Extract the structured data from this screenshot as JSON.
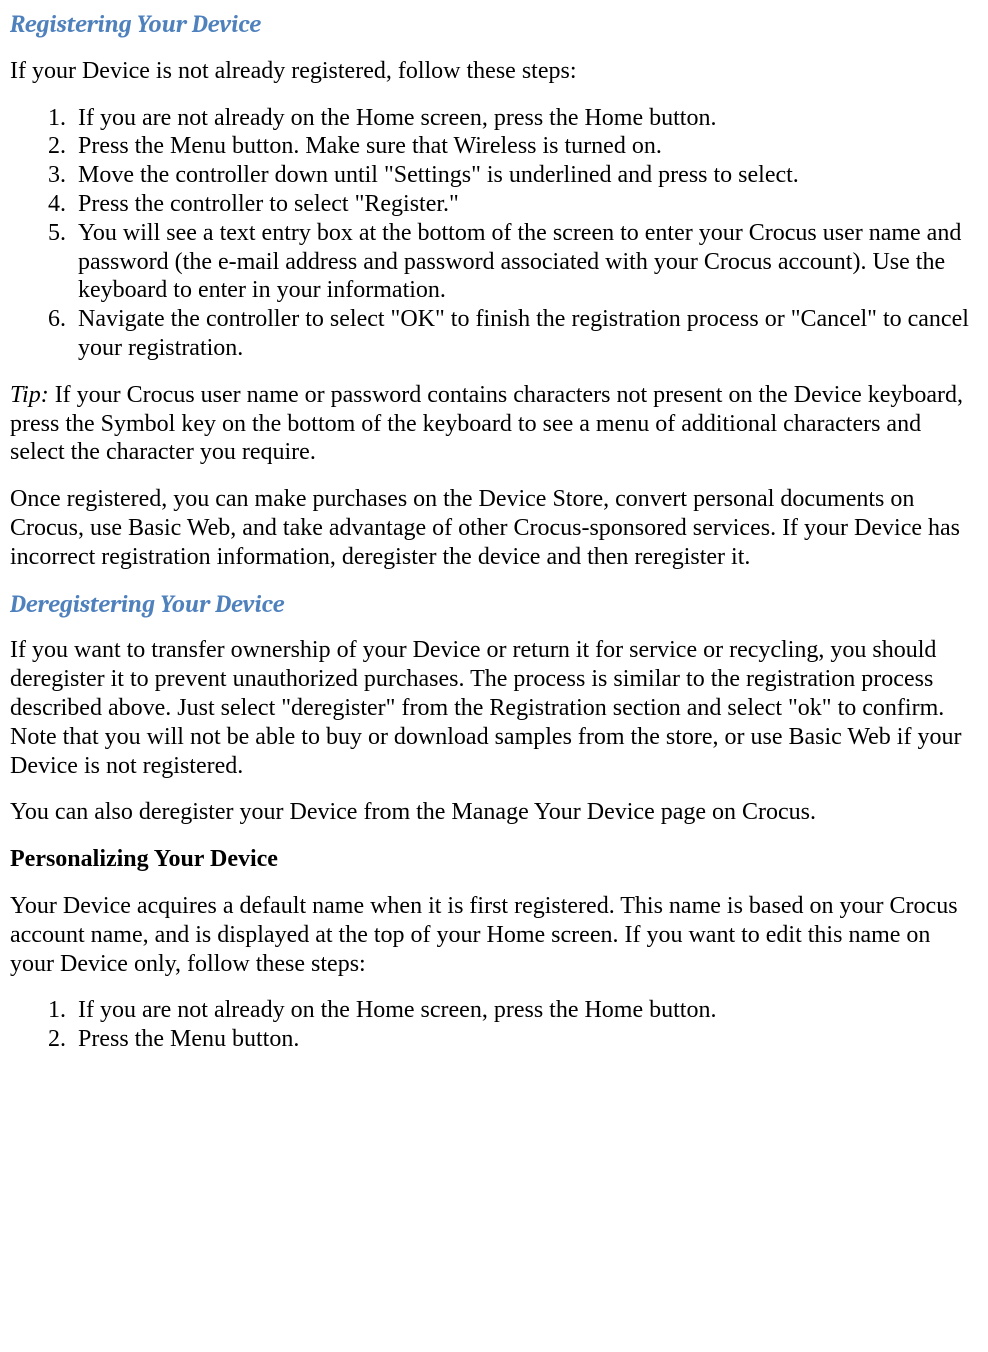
{
  "heading1": "Registering Your Device",
  "para1": "If your Device is not already registered, follow these steps:",
  "list1": [
    "If you are not already on the Home screen, press the Home button.",
    "Press the Menu button. Make sure that Wireless is turned on.",
    "Move the controller down until \"Settings\" is underlined and press to select.",
    "Press the controller to select \"Register.\"",
    "You will see a text entry box at the bottom of the screen to enter your Crocus user name and password (the e-mail address and password associated with your Crocus account). Use the keyboard to enter in your information.",
    "Navigate the controller to select \"OK\" to finish the registration process or \"Cancel\" to cancel your registration."
  ],
  "tip_label": "Tip:",
  "tip_body": " If your Crocus user name or password contains characters not present on the Device keyboard, press the Symbol key on the bottom of the keyboard to see a menu of additional characters and select the character you require.",
  "para2": "Once registered, you can make purchases on the Device Store, convert personal documents on Crocus, use Basic Web, and take advantage of other Crocus-sponsored services. If your Device has incorrect registration information, deregister the device and then reregister it.",
  "heading2": "Deregistering Your Device",
  "para3": "If you want to transfer ownership of your Device or return it for service or recycling, you should deregister it to prevent unauthorized purchases. The process is similar to the registration process described above. Just select \"deregister\" from the Registration section and select \"ok\" to confirm. Note that you will not be able to buy or download samples from the store, or use Basic Web if your Device is not registered.",
  "para4": "You can also deregister your Device from the Manage Your Device page on Crocus.",
  "heading3": "Personalizing Your Device",
  "para5": "Your Device acquires a default name when it is first registered. This name is based on your Crocus account name, and is displayed at the top of your Home screen. If you want to edit this name on your Device only, follow these steps:",
  "list2": [
    "If you are not already on the Home screen, press the Home button.",
    "Press the Menu button."
  ]
}
